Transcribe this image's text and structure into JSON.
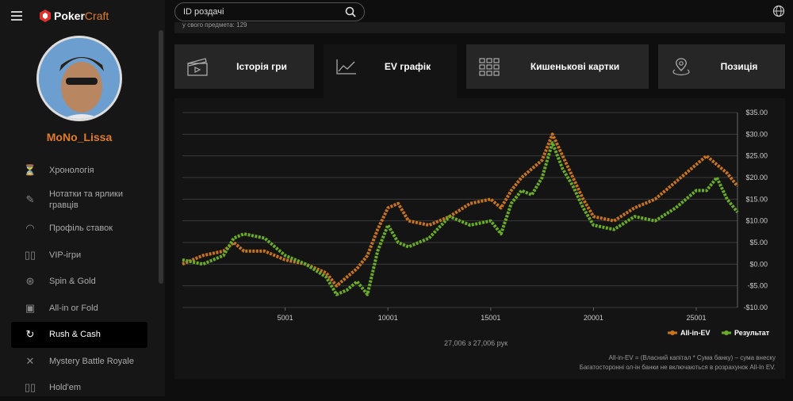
{
  "app": {
    "brand_part1": "Poker",
    "brand_part2": "Craft"
  },
  "user": {
    "name": "MoNo_Lissa"
  },
  "nav": {
    "items": [
      {
        "label": "Хронологія",
        "icon": "timeline-icon"
      },
      {
        "label": "Нотатки та ярлики гравців",
        "icon": "notes-icon"
      },
      {
        "label": "Профіль ставок",
        "icon": "gauge-icon"
      },
      {
        "label": "VIP-ігри",
        "icon": "vip-cards-icon"
      },
      {
        "label": "Spin & Gold",
        "icon": "spin-icon"
      },
      {
        "label": "All-in or Fold",
        "icon": "allin-icon"
      },
      {
        "label": "Rush & Cash",
        "icon": "rush-icon"
      },
      {
        "label": "Mystery Battle Royale",
        "icon": "mystery-icon"
      },
      {
        "label": "Hold'em",
        "icon": "holdem-icon"
      }
    ],
    "active_index": 6
  },
  "search": {
    "placeholder": "ID роздачі"
  },
  "subbar": {
    "text": "у свого предмета: 129"
  },
  "tabs": [
    {
      "label": "Історія гри",
      "icon": "clapperboard-icon"
    },
    {
      "label": "EV графік",
      "icon": "line-chart-icon"
    },
    {
      "label": "Кишенькові картки",
      "icon": "grid-icon"
    },
    {
      "label": "Позиція",
      "icon": "location-icon"
    }
  ],
  "active_tab": 1,
  "chart_footer": {
    "count": "27,006 з 27,006 рук",
    "note1": "All-in-EV = (Власний капітал * Сума банку) – сума внеску",
    "note2": "Багатосторонні ол-ін банки не включаються в розрахунок All-In EV."
  },
  "chart_data": {
    "type": "line",
    "xlim": [
      1,
      27006
    ],
    "ylim": [
      -10,
      35
    ],
    "x_ticks": [
      5001,
      10001,
      15001,
      20001,
      25001
    ],
    "x_tick_labels": [
      "5001",
      "10001",
      "15001",
      "20001",
      "25001"
    ],
    "y_ticks": [
      35,
      30,
      25,
      20,
      15,
      10,
      5,
      0,
      -5,
      -10
    ],
    "y_tick_labels": [
      "$35.00",
      "$30.00",
      "$25.00",
      "$20.00",
      "$15.00",
      "$10.00",
      "$5.00",
      "$0.00",
      "-$5.00",
      "-$10.00"
    ],
    "grid": true,
    "legend_position": "bottom-right",
    "x": [
      1,
      1000,
      2000,
      2500,
      3000,
      4000,
      5000,
      6000,
      7000,
      7500,
      8000,
      8500,
      9000,
      9500,
      10000,
      10500,
      11000,
      12000,
      13000,
      14000,
      15000,
      15500,
      16000,
      16500,
      17000,
      17500,
      18000,
      18500,
      19000,
      19500,
      20000,
      21000,
      22000,
      23000,
      24000,
      25000,
      25500,
      26000,
      26500,
      27006
    ],
    "series": [
      {
        "name": "All-in-EV",
        "color": "#c8741e",
        "values": [
          0,
          2,
          3,
          5,
          3,
          3,
          1,
          0,
          -2,
          -5,
          -3,
          -1,
          2,
          8,
          13,
          14,
          10,
          9,
          11,
          14,
          15,
          13,
          17,
          20,
          22,
          24,
          30,
          25,
          20,
          15,
          11,
          10,
          13,
          15,
          19,
          23,
          25,
          23,
          21,
          18
        ]
      },
      {
        "name": "Результат",
        "color": "#6aad24",
        "values": [
          1,
          0,
          2,
          6,
          7,
          6,
          2,
          0,
          -3,
          -7,
          -6,
          -4,
          -7,
          3,
          9,
          5,
          4,
          6,
          11,
          9,
          10,
          7,
          14,
          17,
          16,
          20,
          28,
          22,
          18,
          13,
          9,
          8,
          11,
          10,
          13,
          17,
          17,
          20,
          15,
          12
        ]
      }
    ]
  },
  "colors": {
    "accent": "#e07b2a",
    "ev": "#c8741e",
    "result": "#6aad24"
  }
}
